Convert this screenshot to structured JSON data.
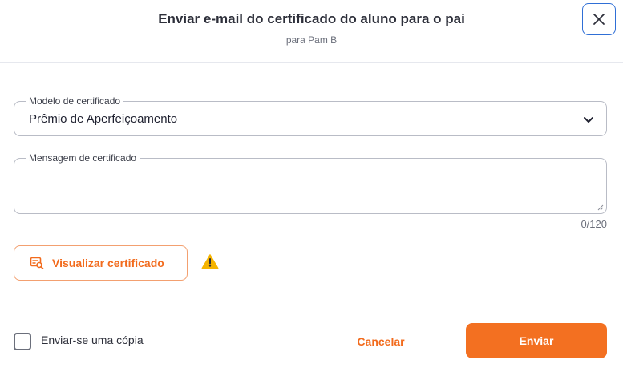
{
  "header": {
    "title": "Enviar e-mail do certificado do aluno para o pai",
    "subtitle": "para Pam B"
  },
  "form": {
    "template_label": "Modelo de certificado",
    "template_value": "Prêmio de Aperfeiçoamento",
    "message_label": "Mensagem de certificado",
    "message_value": "",
    "message_counter": "0/120"
  },
  "preview_button": {
    "label": "Visualizar certificado"
  },
  "copy": {
    "label": "Enviar-se uma cópia",
    "checked": false
  },
  "actions": {
    "cancel_label": "Cancelar",
    "send_label": "Enviar"
  },
  "colors": {
    "accent": "#f37021",
    "focus": "#2f6fd6",
    "warning": "#f5b400"
  },
  "icons": {
    "close": "close-icon",
    "chevron": "chevron-down-icon",
    "preview": "certificate-search-icon",
    "warning": "warning-icon"
  }
}
